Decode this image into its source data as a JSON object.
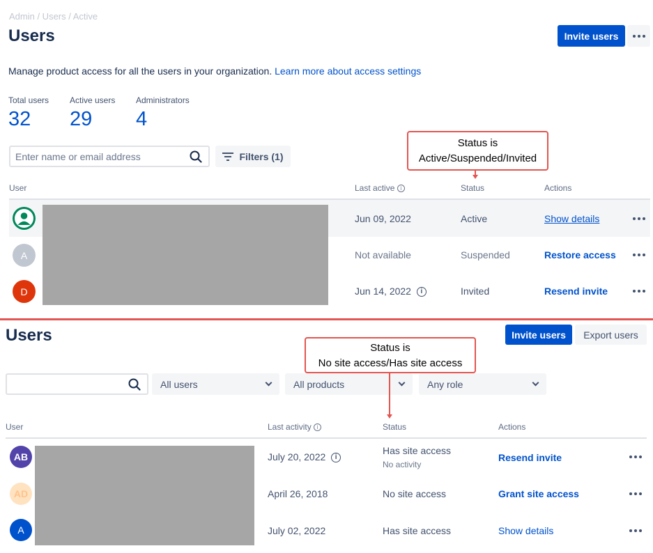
{
  "top": {
    "breadcrumb": "Admin / Users / Active",
    "title": "Users",
    "invite_label": "Invite users",
    "description": "Manage product access for all the users in your organization.",
    "learn_more": "Learn more about access settings",
    "stats": [
      {
        "label": "Total users",
        "value": "32"
      },
      {
        "label": "Active users",
        "value": "29"
      },
      {
        "label": "Administrators",
        "value": "4"
      }
    ],
    "search_placeholder": "Enter name or email address",
    "filters_label": "Filters (1)",
    "columns": {
      "user": "User",
      "last_active": "Last active",
      "status": "Status",
      "actions": "Actions"
    },
    "rows": [
      {
        "last_active": "Jun 09, 2022",
        "status": "Active",
        "action": "Show details"
      },
      {
        "avatar": "A",
        "last_active": "Not available",
        "status": "Suspended",
        "action": "Restore access"
      },
      {
        "avatar": "D",
        "last_active": "Jun 14, 2022",
        "status": "Invited",
        "action": "Resend invite"
      }
    ],
    "callout": {
      "line1": "Status is",
      "line2": "Active/Suspended/Invited"
    }
  },
  "bottom": {
    "title": "Users",
    "invite_label": "Invite users",
    "export_label": "Export users",
    "filters": {
      "users": "All users",
      "products": "All products",
      "role": "Any role"
    },
    "columns": {
      "user": "User",
      "last_activity": "Last activity",
      "status": "Status",
      "actions": "Actions"
    },
    "rows": [
      {
        "avatar": "AB",
        "last_activity": "July 20, 2022",
        "status": "Has site access",
        "substatus": "No activity",
        "action": "Resend invite"
      },
      {
        "avatar": "AD",
        "last_activity": "April 26, 2018",
        "status": "No site access",
        "action": "Grant site access"
      },
      {
        "avatar": "A",
        "last_activity": "July 02, 2022",
        "status": "Has site access",
        "action": "Show details"
      }
    ],
    "callout": {
      "line1": "Status is",
      "line2": "No site access/Has site access"
    }
  },
  "colors": {
    "brand_blue": "#0052cc",
    "annotation_red": "#e25550",
    "redaction_grey": "#a6a6a6"
  }
}
